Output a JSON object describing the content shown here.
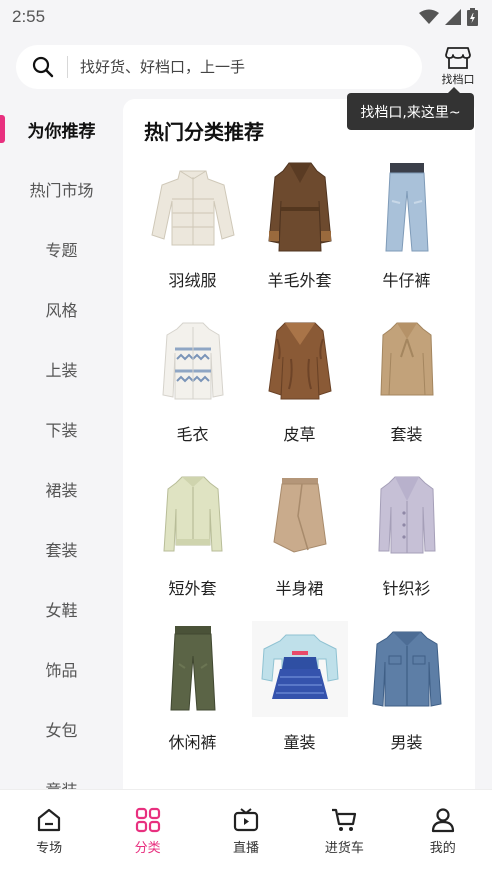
{
  "status": {
    "time": "2:55"
  },
  "search": {
    "placeholder": "找好货、好档口，上一手"
  },
  "find_stall": {
    "label": "找档口",
    "tooltip": "找档口,来这里~"
  },
  "sidebar": {
    "items": [
      {
        "label": "为你推荐",
        "active": true
      },
      {
        "label": "热门市场"
      },
      {
        "label": "专题"
      },
      {
        "label": "风格"
      },
      {
        "label": "上装"
      },
      {
        "label": "下装"
      },
      {
        "label": "裙装"
      },
      {
        "label": "套装"
      },
      {
        "label": "女鞋"
      },
      {
        "label": "饰品"
      },
      {
        "label": "女包"
      },
      {
        "label": "童装"
      }
    ]
  },
  "main": {
    "title": "热门分类推荐",
    "categories": [
      {
        "label": "羽绒服",
        "icon": "puffer-jacket-icon"
      },
      {
        "label": "羊毛外套",
        "icon": "wool-coat-icon"
      },
      {
        "label": "牛仔裤",
        "icon": "jeans-icon"
      },
      {
        "label": "毛衣",
        "icon": "sweater-icon"
      },
      {
        "label": "皮草",
        "icon": "fur-coat-icon"
      },
      {
        "label": "套装",
        "icon": "outfit-set-icon"
      },
      {
        "label": "短外套",
        "icon": "short-jacket-icon"
      },
      {
        "label": "半身裙",
        "icon": "skirt-icon"
      },
      {
        "label": "针织衫",
        "icon": "cardigan-icon"
      },
      {
        "label": "休闲裤",
        "icon": "casual-pants-icon"
      },
      {
        "label": "童装",
        "icon": "kidswear-icon"
      },
      {
        "label": "男装",
        "icon": "menswear-icon"
      }
    ]
  },
  "bottom_nav": {
    "items": [
      {
        "label": "专场",
        "icon": "home-icon"
      },
      {
        "label": "分类",
        "icon": "category-icon",
        "active": true
      },
      {
        "label": "直播",
        "icon": "live-tv-icon"
      },
      {
        "label": "进货车",
        "icon": "cart-icon"
      },
      {
        "label": "我的",
        "icon": "profile-icon"
      }
    ]
  },
  "colors": {
    "accent": "#e8307f",
    "background": "#f5f5f7",
    "tooltip_bg": "#333333"
  }
}
